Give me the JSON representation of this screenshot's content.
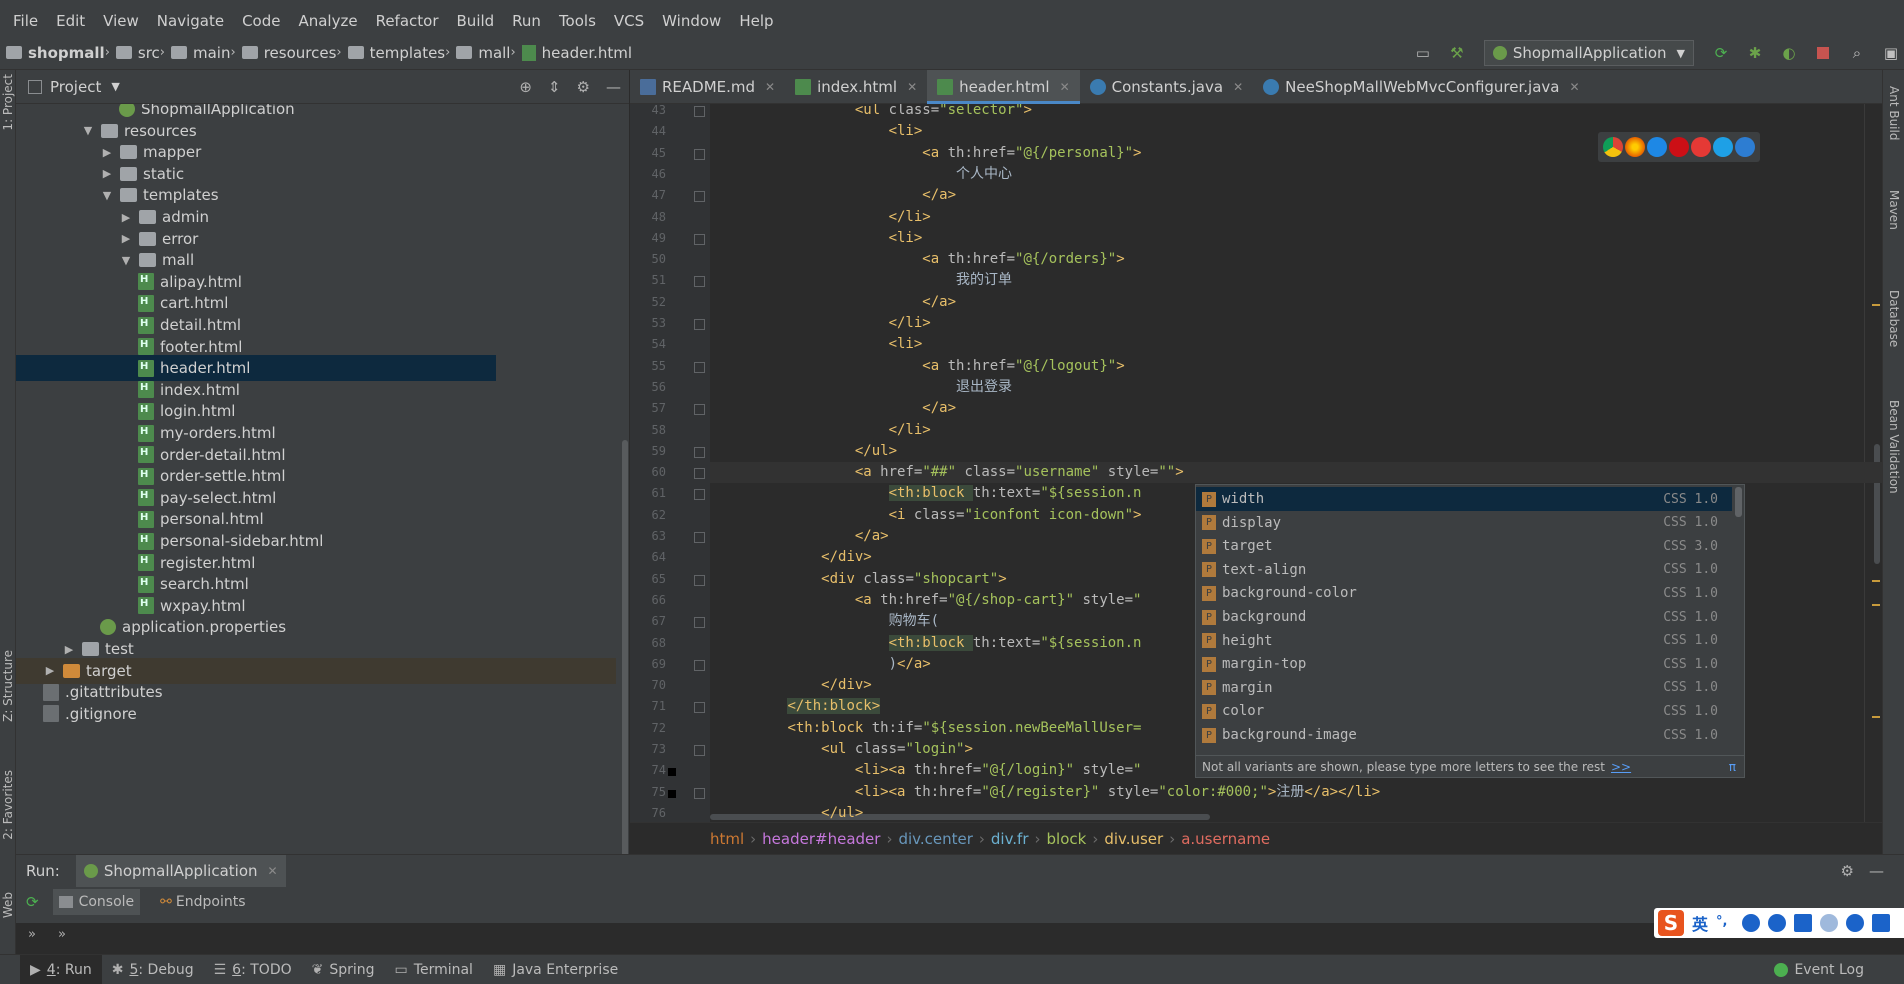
{
  "menu": [
    "File",
    "Edit",
    "View",
    "Navigate",
    "Code",
    "Analyze",
    "Refactor",
    "Build",
    "Run",
    "Tools",
    "VCS",
    "Window",
    "Help"
  ],
  "breadcrumb": [
    "shopmall",
    "src",
    "main",
    "resources",
    "templates",
    "mall",
    "header.html"
  ],
  "run_config": {
    "label": "ShopmallApplication"
  },
  "left_stripe": {
    "project": "1: Project",
    "structure": "Z: Structure",
    "favorites": "2: Favorites",
    "web": "Web"
  },
  "right_stripe": {
    "ant": "Ant Build",
    "maven": "Maven",
    "database": "Database",
    "bean": "Bean Validation"
  },
  "project_panel": {
    "title": "Project",
    "tree": [
      {
        "label": "ShopmallApplication",
        "type": "spring",
        "depth": 5
      },
      {
        "label": "resources",
        "type": "folder-open",
        "depth": 3
      },
      {
        "label": "mapper",
        "type": "folder",
        "depth": 4
      },
      {
        "label": "static",
        "type": "folder",
        "depth": 4
      },
      {
        "label": "templates",
        "type": "folder-open",
        "depth": 4
      },
      {
        "label": "admin",
        "type": "folder",
        "depth": 5
      },
      {
        "label": "error",
        "type": "folder",
        "depth": 5
      },
      {
        "label": "mall",
        "type": "folder-open",
        "depth": 5
      },
      {
        "label": "alipay.html",
        "type": "html",
        "depth": 6
      },
      {
        "label": "cart.html",
        "type": "html",
        "depth": 6
      },
      {
        "label": "detail.html",
        "type": "html",
        "depth": 6
      },
      {
        "label": "footer.html",
        "type": "html",
        "depth": 6
      },
      {
        "label": "header.html",
        "type": "html",
        "depth": 6,
        "selected": true
      },
      {
        "label": "index.html",
        "type": "html",
        "depth": 6
      },
      {
        "label": "login.html",
        "type": "html",
        "depth": 6
      },
      {
        "label": "my-orders.html",
        "type": "html",
        "depth": 6
      },
      {
        "label": "order-detail.html",
        "type": "html",
        "depth": 6
      },
      {
        "label": "order-settle.html",
        "type": "html",
        "depth": 6
      },
      {
        "label": "pay-select.html",
        "type": "html",
        "depth": 6
      },
      {
        "label": "personal.html",
        "type": "html",
        "depth": 6
      },
      {
        "label": "personal-sidebar.html",
        "type": "html",
        "depth": 6
      },
      {
        "label": "register.html",
        "type": "html",
        "depth": 6
      },
      {
        "label": "search.html",
        "type": "html",
        "depth": 6
      },
      {
        "label": "wxpay.html",
        "type": "html",
        "depth": 6
      },
      {
        "label": "application.properties",
        "type": "spring",
        "depth": 4
      },
      {
        "label": "test",
        "type": "folder",
        "depth": 2
      },
      {
        "label": "target",
        "type": "folder-orange",
        "depth": 1,
        "target": true
      },
      {
        "label": ".gitattributes",
        "type": "git",
        "depth": 1
      },
      {
        "label": ".gitignore",
        "type": "git",
        "depth": 1
      }
    ]
  },
  "editor_tabs": [
    {
      "label": "README.md",
      "icon": "md"
    },
    {
      "label": "index.html",
      "icon": "html"
    },
    {
      "label": "header.html",
      "icon": "html",
      "active": true
    },
    {
      "label": "Constants.java",
      "icon": "java"
    },
    {
      "label": "NeeShopMallWebMvcConfigurer.java",
      "icon": "java"
    }
  ],
  "code_lines": [
    {
      "n": "43",
      "indent": 16,
      "html": "<span class=\"tag\">&lt;ul </span><span class=\"attr\">class=</span><span class=\"str\">\"selector\"</span><span class=\"tag\">&gt;</span>"
    },
    {
      "n": "44",
      "indent": 20,
      "html": "<span class=\"tag\">&lt;li&gt;</span>"
    },
    {
      "n": "45",
      "indent": 24,
      "html": "<span class=\"tag\">&lt;a </span><span class=\"attr\">th:href=</span><span class=\"str\">\"@{/personal}\"</span><span class=\"tag\">&gt;</span>"
    },
    {
      "n": "46",
      "indent": 28,
      "html": "<span class=\"txt\">个人中心</span>"
    },
    {
      "n": "47",
      "indent": 24,
      "html": "<span class=\"tag\">&lt;/a&gt;</span>"
    },
    {
      "n": "48",
      "indent": 20,
      "html": "<span class=\"tag\">&lt;/li&gt;</span>"
    },
    {
      "n": "49",
      "indent": 20,
      "html": "<span class=\"tag\">&lt;li&gt;</span>"
    },
    {
      "n": "50",
      "indent": 24,
      "html": "<span class=\"tag\">&lt;a </span><span class=\"attr\">th:href=</span><span class=\"str\">\"@{/orders}\"</span><span class=\"tag\">&gt;</span>"
    },
    {
      "n": "51",
      "indent": 28,
      "html": "<span class=\"txt\">我的订单</span>"
    },
    {
      "n": "52",
      "indent": 24,
      "html": "<span class=\"tag\">&lt;/a&gt;</span>"
    },
    {
      "n": "53",
      "indent": 20,
      "html": "<span class=\"tag\">&lt;/li&gt;</span>"
    },
    {
      "n": "54",
      "indent": 20,
      "html": "<span class=\"tag\">&lt;li&gt;</span>"
    },
    {
      "n": "55",
      "indent": 24,
      "html": "<span class=\"tag\">&lt;a </span><span class=\"attr\">th:href=</span><span class=\"str\">\"@{/logout}\"</span><span class=\"tag\">&gt;</span>"
    },
    {
      "n": "56",
      "indent": 28,
      "html": "<span class=\"txt\">退出登录</span>"
    },
    {
      "n": "57",
      "indent": 24,
      "html": "<span class=\"tag\">&lt;/a&gt;</span>"
    },
    {
      "n": "58",
      "indent": 20,
      "html": "<span class=\"tag\">&lt;/li&gt;</span>"
    },
    {
      "n": "59",
      "indent": 16,
      "html": "<span class=\"tag\">&lt;/ul&gt;</span>"
    },
    {
      "n": "60",
      "indent": 16,
      "caret": true,
      "html": "<span class=\"tag\">&lt;a </span><span class=\"attr\">href=</span><span class=\"str\">\"##\"</span> <span class=\"attr\">class=</span><span class=\"str\">\"username\"</span> <span class=\"attr\">style=</span><span class=\"str\">\"\"</span><span class=\"tag\">&gt;</span>"
    },
    {
      "n": "61",
      "indent": 20,
      "html": "<span class=\"tag hl\">&lt;th:block </span><span class=\"attr\">th:text=</span><span class=\"str\">\"${session.n</span>"
    },
    {
      "n": "62",
      "indent": 20,
      "html": "<span class=\"tag\">&lt;i </span><span class=\"attr\">class=</span><span class=\"str\">\"iconfont icon-down\"</span><span class=\"tag\">&gt;</span>"
    },
    {
      "n": "63",
      "indent": 16,
      "html": "<span class=\"tag\">&lt;/a&gt;</span>"
    },
    {
      "n": "64",
      "indent": 12,
      "html": "<span class=\"tag\">&lt;/div&gt;</span>"
    },
    {
      "n": "65",
      "indent": 12,
      "html": "<span class=\"tag\">&lt;div </span><span class=\"attr\">class=</span><span class=\"str\">\"shopcart\"</span><span class=\"tag\">&gt;</span>"
    },
    {
      "n": "66",
      "indent": 16,
      "html": "<span class=\"tag\">&lt;a </span><span class=\"attr\">th:href=</span><span class=\"str\">\"@{/shop-cart}\"</span> <span class=\"attr\">style=</span><span class=\"str\">\"</span>"
    },
    {
      "n": "67",
      "indent": 20,
      "html": "<span class=\"txt\">购物车(</span>"
    },
    {
      "n": "68",
      "indent": 20,
      "html": "<span class=\"tag hl\">&lt;th:block </span><span class=\"attr\">th:text=</span><span class=\"str\">\"${session.n</span>"
    },
    {
      "n": "69",
      "indent": 20,
      "html": "<span class=\"txt\">)</span><span class=\"tag\">&lt;/a&gt;</span>"
    },
    {
      "n": "70",
      "indent": 12,
      "html": "<span class=\"tag\">&lt;/div&gt;</span>"
    },
    {
      "n": "71",
      "indent": 8,
      "html": "<span class=\"tag hl\">&lt;/th:block&gt;</span>"
    },
    {
      "n": "72",
      "indent": 8,
      "html": "<span class=\"tag\">&lt;th:block </span><span class=\"attr\">th:if=</span><span class=\"str\">\"${session.newBeeMallUser=</span>"
    },
    {
      "n": "73",
      "indent": 12,
      "html": "<span class=\"tag\">&lt;ul </span><span class=\"attr\">class=</span><span class=\"str\">\"login\"</span><span class=\"tag\">&gt;</span>"
    },
    {
      "n": "74",
      "indent": 16,
      "html": "<span class=\"tag\">&lt;li&gt;&lt;a </span><span class=\"attr\">th:href=</span><span class=\"str\">\"@{/login}\"</span> <span class=\"attr\">style=</span><span class=\"str\">\"</span>"
    },
    {
      "n": "75",
      "indent": 16,
      "html": "<span class=\"tag\">&lt;li&gt;&lt;a </span><span class=\"attr\">th:href=</span><span class=\"str\">\"@{/register}\"</span> <span class=\"attr\">style=</span><span class=\"str\">\"color:#000;\"</span><span class=\"tag\">&gt;</span><span class=\"txt\">注册</span><span class=\"tag\">&lt;/a&gt;&lt;/li&gt;</span>"
    },
    {
      "n": "76",
      "indent": 12,
      "html": "<span class=\"tag\">&lt;/ul&gt;</span>"
    }
  ],
  "completion": {
    "items": [
      {
        "name": "width",
        "type": "CSS 1.0",
        "selected": true
      },
      {
        "name": "display",
        "type": "CSS 1.0"
      },
      {
        "name": "target",
        "type": "CSS 3.0"
      },
      {
        "name": "text-align",
        "type": "CSS 1.0"
      },
      {
        "name": "background-color",
        "type": "CSS 1.0"
      },
      {
        "name": "background",
        "type": "CSS 1.0"
      },
      {
        "name": "height",
        "type": "CSS 1.0"
      },
      {
        "name": "margin-top",
        "type": "CSS 1.0"
      },
      {
        "name": "margin",
        "type": "CSS 1.0"
      },
      {
        "name": "color",
        "type": "CSS 1.0"
      },
      {
        "name": "background-image",
        "type": "CSS 1.0"
      }
    ],
    "footer": "Not all variants are shown, please type more letters to see the rest",
    "more": ">>",
    "pi": "π"
  },
  "editor_breadcrumb": [
    {
      "label": "html",
      "color": "#cc7832"
    },
    {
      "label": "header#header",
      "color": "#c678dd"
    },
    {
      "label": "div.center",
      "color": "#6897bb"
    },
    {
      "label": "div.fr",
      "color": "#6bb0d0"
    },
    {
      "label": "block",
      "color": "#a5c25c"
    },
    {
      "label": "div.user",
      "color": "#e8bf6a"
    },
    {
      "label": "a.username",
      "color": "#e06c60"
    }
  ],
  "run_panel": {
    "label": "Run:",
    "tab": "ShopmallApplication",
    "subtabs": [
      "Console",
      "Endpoints"
    ]
  },
  "bottom_tabs": [
    {
      "key": "4",
      "label": ": Run",
      "active": true
    },
    {
      "key": "5",
      "label": ": Debug"
    },
    {
      "key": "6",
      "label": ": TODO"
    },
    {
      "key": "",
      "label": "Spring"
    },
    {
      "key": "",
      "label": "Terminal"
    },
    {
      "key": "",
      "label": "Java Enterprise"
    }
  ],
  "event_log": "Event Log",
  "ime": {
    "logo": "S",
    "mode": "英"
  }
}
